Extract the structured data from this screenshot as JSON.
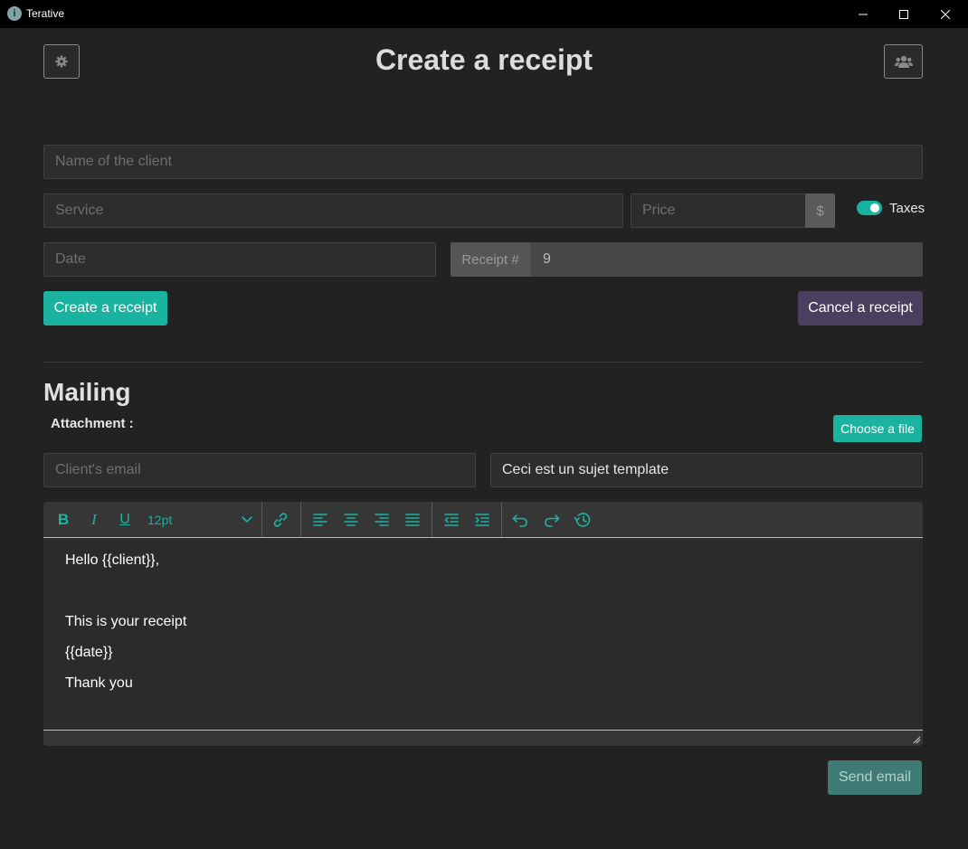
{
  "window": {
    "title": "Terative"
  },
  "header": {
    "title": "Create a receipt",
    "settings_icon": "gear-icon",
    "clients_icon": "users-icon"
  },
  "form": {
    "client_name_placeholder": "Name of the client",
    "service_placeholder": "Service",
    "price_placeholder": "Price",
    "price_addon": "$",
    "taxes_label": "Taxes",
    "taxes_enabled": true,
    "date_placeholder": "Date",
    "receipt_addon": "Receipt #",
    "receipt_number": "9",
    "create_label": "Create a receipt",
    "cancel_label": "Cancel a receipt"
  },
  "mailing": {
    "title": "Mailing",
    "attachment_label": "Attachment :",
    "choose_file_label": "Choose a file",
    "email_placeholder": "Client's email",
    "subject_value": "Ceci est un sujet template",
    "font_size": "12pt",
    "body_lines": [
      "Hello {{client}},",
      "",
      "This is your receipt",
      "{{date}}",
      "Thank you"
    ],
    "send_label": "Send email"
  },
  "colors": {
    "accent": "#1ab3a0",
    "cancel": "#4a3f5f",
    "background": "#222222"
  }
}
